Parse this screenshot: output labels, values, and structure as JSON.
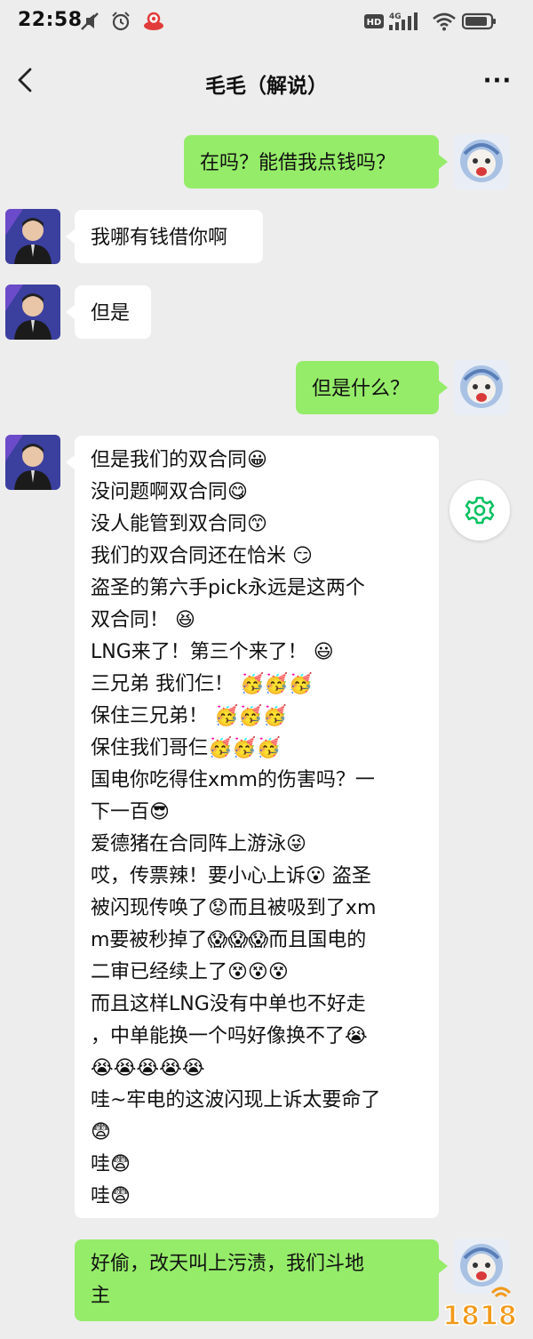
{
  "status_bar": {
    "time": "22:58",
    "network_label": "4G",
    "hd_label": "HD"
  },
  "header": {
    "title": "毛毛（解说）",
    "back_icon": "chevron-left-icon",
    "more_label": "···"
  },
  "messages": [
    {
      "side": "out",
      "lines": [
        "在吗？能借我点钱吗？"
      ]
    },
    {
      "side": "in",
      "lines": [
        "我哪有钱借你啊"
      ]
    },
    {
      "side": "in",
      "lines": [
        "但是"
      ]
    },
    {
      "side": "out",
      "lines": [
        "但是什么？"
      ]
    },
    {
      "side": "in",
      "lines": [
        "但是我们的双合同😀",
        "没问题啊双合同😋",
        "没人能管到双合同😙",
        "我们的双合同还在恰米 😏",
        "盗圣的第六手pick永远是这两个",
        "双合同！ 😆",
        "LNG来了！第三个来了！ 😃",
        "三兄弟 我们仨！ 🥳🥳🥳",
        "保住三兄弟！ 🥳🥳🥳",
        "保住我们哥仨🥳🥳🥳",
        "国电你吃得住xmm的伤害吗？一",
        "下一百😎",
        "爱德猪在合同阵上游泳😜",
        "哎，传票辣！要小心上诉😮 盗圣",
        "被闪现传唤了😟而且被吸到了xm",
        "m要被秒掉了😱😱😱而且国电的",
        "二审已经续上了😵😵😵",
        "而且这样LNG没有中单也不好走",
        "，中单能换一个吗好像换不了😭",
        "😭😭😭😭😭",
        "哇~牢电的这波闪现上诉太要命了",
        "😨",
        "哇😨",
        "哇😨"
      ]
    },
    {
      "side": "out",
      "lines": [
        "好偷，改天叫上污渍，我们斗地",
        "主"
      ]
    }
  ],
  "watermark": "1818",
  "colors": {
    "background": "#ededed",
    "outgoing_bubble": "#95ec69",
    "incoming_bubble": "#ffffff",
    "accent_green": "#07c160",
    "watermark_orange": "#f29a1b"
  }
}
